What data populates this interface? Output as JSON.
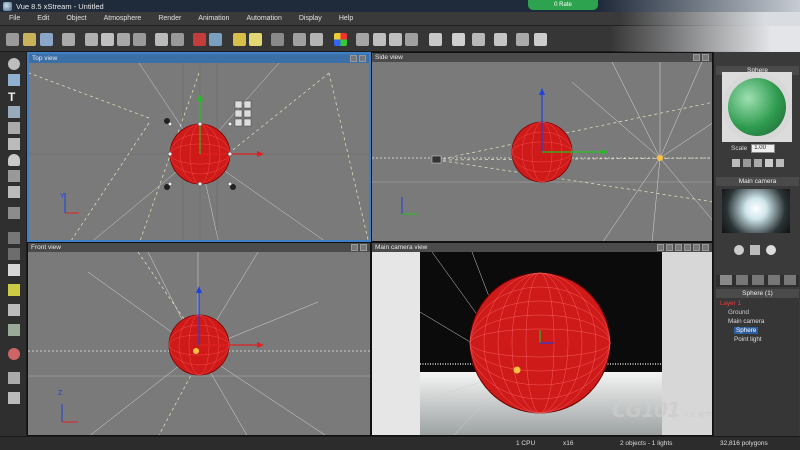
{
  "window": {
    "title": "Vue 8.5 xStream - Untitled",
    "badge": "0 Rate"
  },
  "menu": [
    "File",
    "Edit",
    "Object",
    "Atmosphere",
    "Render",
    "Animation",
    "Automation",
    "Display",
    "Help"
  ],
  "viewports": {
    "top": {
      "label": "Top view"
    },
    "side": {
      "label": "Side view"
    },
    "front": {
      "label": "Front view"
    },
    "camera": {
      "label": "Main camera view"
    }
  },
  "right_panel": {
    "object_title": "Sphere",
    "scale_label": "Scale",
    "scale_value": "1.00",
    "camera_title": "Main camera",
    "tree_title": "Sphere (1)",
    "tree": [
      "Layer 1",
      "Ground",
      "Main camera",
      "Sphere",
      "Point light"
    ]
  },
  "status": {
    "cpu": "1 CPU",
    "zoom": "x16",
    "objects": "2 objects - 1 lights",
    "polygons": "32,816 polygons"
  },
  "watermark": {
    "brand": "CG101",
    "sub": "VUE 教学"
  },
  "colors": {
    "sphere": "#d41a1a",
    "active_viewport": "#3f7fc6",
    "axis_x": "#e02020",
    "axis_y": "#20c020",
    "axis_z": "#2040e0"
  }
}
